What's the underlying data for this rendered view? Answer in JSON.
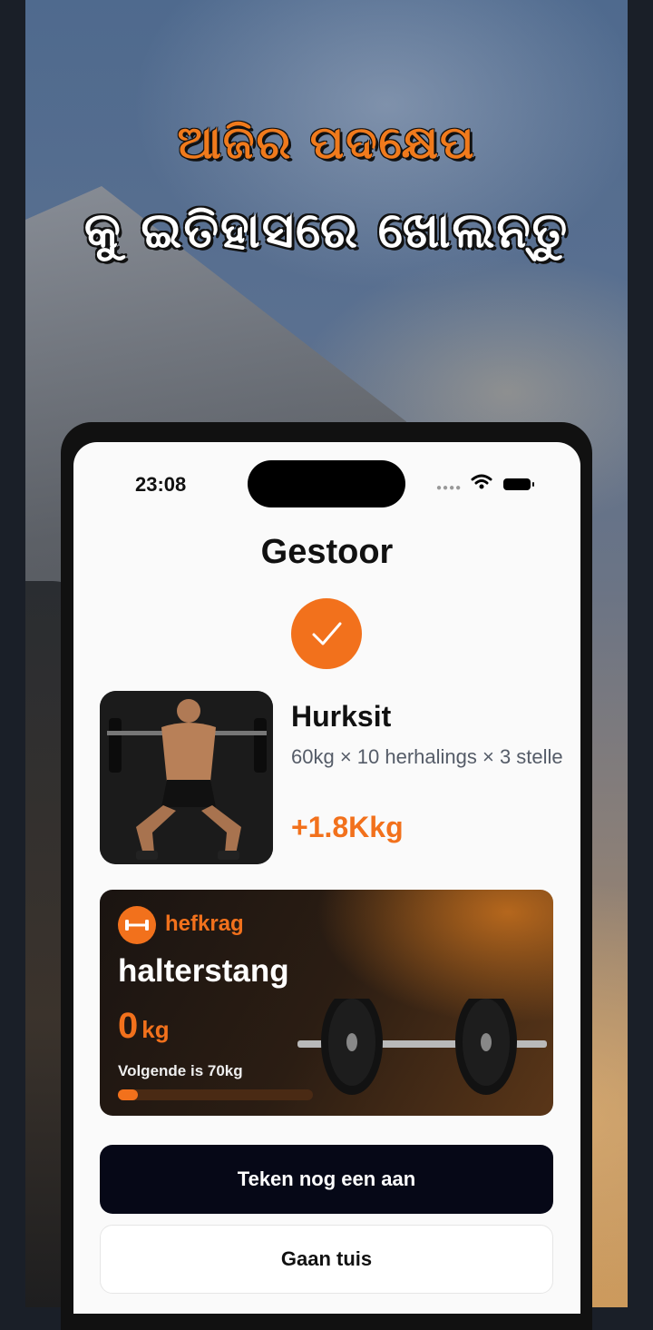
{
  "promo": {
    "headline_line1": "ଆଜିର ପଦକ୍ଷେପ",
    "headline_line2": "କୁ ଇତିହାସରେ ଖୋଲନ୍ତୁ"
  },
  "status_bar": {
    "time": "23:08",
    "icons": [
      "signal-dots-icon",
      "wifi-icon",
      "battery-icon"
    ]
  },
  "screen": {
    "title": "Gestoor",
    "status_icon": "checkmark-icon"
  },
  "exercise": {
    "name": "Hurksit",
    "detail": "60kg × 10 herhalings × 3 stelle",
    "gain": "+1.8Kkg",
    "image": "squat-photo"
  },
  "strength_card": {
    "tag": "hefkrag",
    "name": "halterstang",
    "weight_value": "0",
    "weight_unit": "kg",
    "next_label": "Volgende is 70kg",
    "progress": 0,
    "icon": "dumbbell-icon"
  },
  "actions": {
    "primary_label": "Teken nog een aan",
    "secondary_label": "Gaan tuis"
  },
  "colors": {
    "accent": "#f2711c",
    "primary_button": "#060817"
  }
}
